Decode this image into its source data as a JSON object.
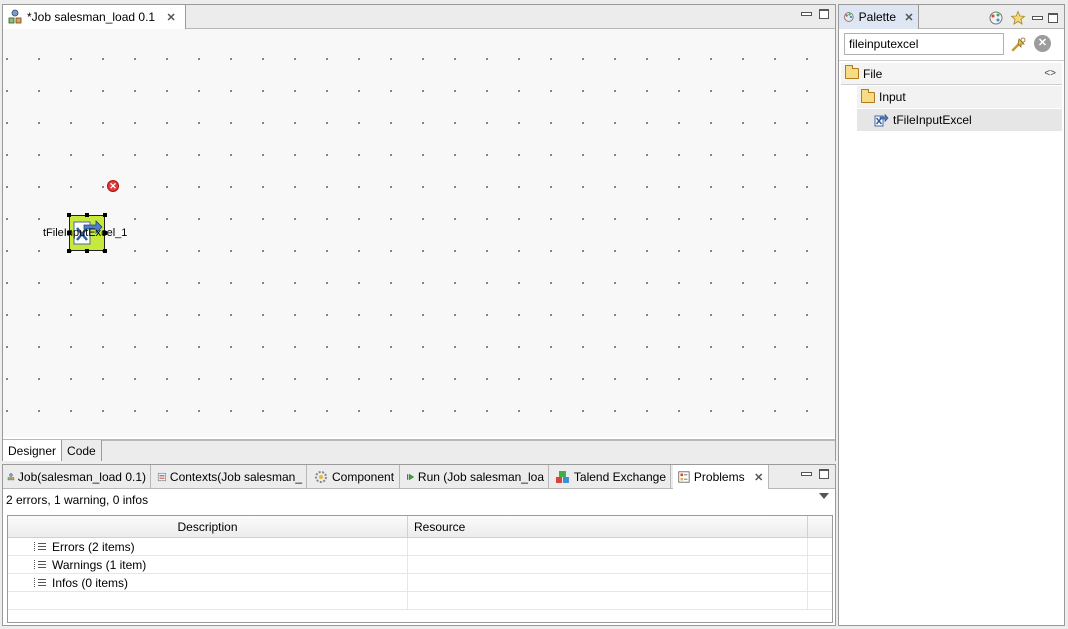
{
  "editor": {
    "tab_title": "*Job salesman_load 0.1",
    "close_glyph": "✕",
    "component_label": "tFileInputExcel_1",
    "error_glyph": "✕",
    "bottom_tabs": [
      "Designer",
      "Code"
    ]
  },
  "bottom_view": {
    "tabs": [
      {
        "label": "Job(salesman_load 0.1)",
        "icon": "job-icon"
      },
      {
        "label": "Contexts(Job salesman_",
        "icon": "contexts-icon"
      },
      {
        "label": "Component",
        "icon": "component-icon"
      },
      {
        "label": "Run (Job salesman_loa",
        "icon": "run-icon"
      },
      {
        "label": "Talend Exchange",
        "icon": "exchange-icon"
      },
      {
        "label": "Problems",
        "icon": "problems-icon"
      }
    ],
    "close_glyph": "✕",
    "summary": "2 errors, 1 warning, 0 infos",
    "columns": [
      "Description",
      "Resource"
    ],
    "rows": [
      {
        "description": "Errors (2 items)",
        "resource": ""
      },
      {
        "description": "Warnings (1 item)",
        "resource": ""
      },
      {
        "description": "Infos (0 items)",
        "resource": ""
      }
    ]
  },
  "palette": {
    "title": "Palette",
    "close_glyph": "✕",
    "search_value": "fileinputexcel",
    "clear_glyph": "✕",
    "root_folder": "File",
    "sub_folder": "Input",
    "item": "tFileInputExcel",
    "collapse_glyph": "<>"
  },
  "colors": {
    "component_fill": "#c7e93e",
    "error_red": "#e23b3b",
    "palette_tab": "#dde6f2"
  }
}
